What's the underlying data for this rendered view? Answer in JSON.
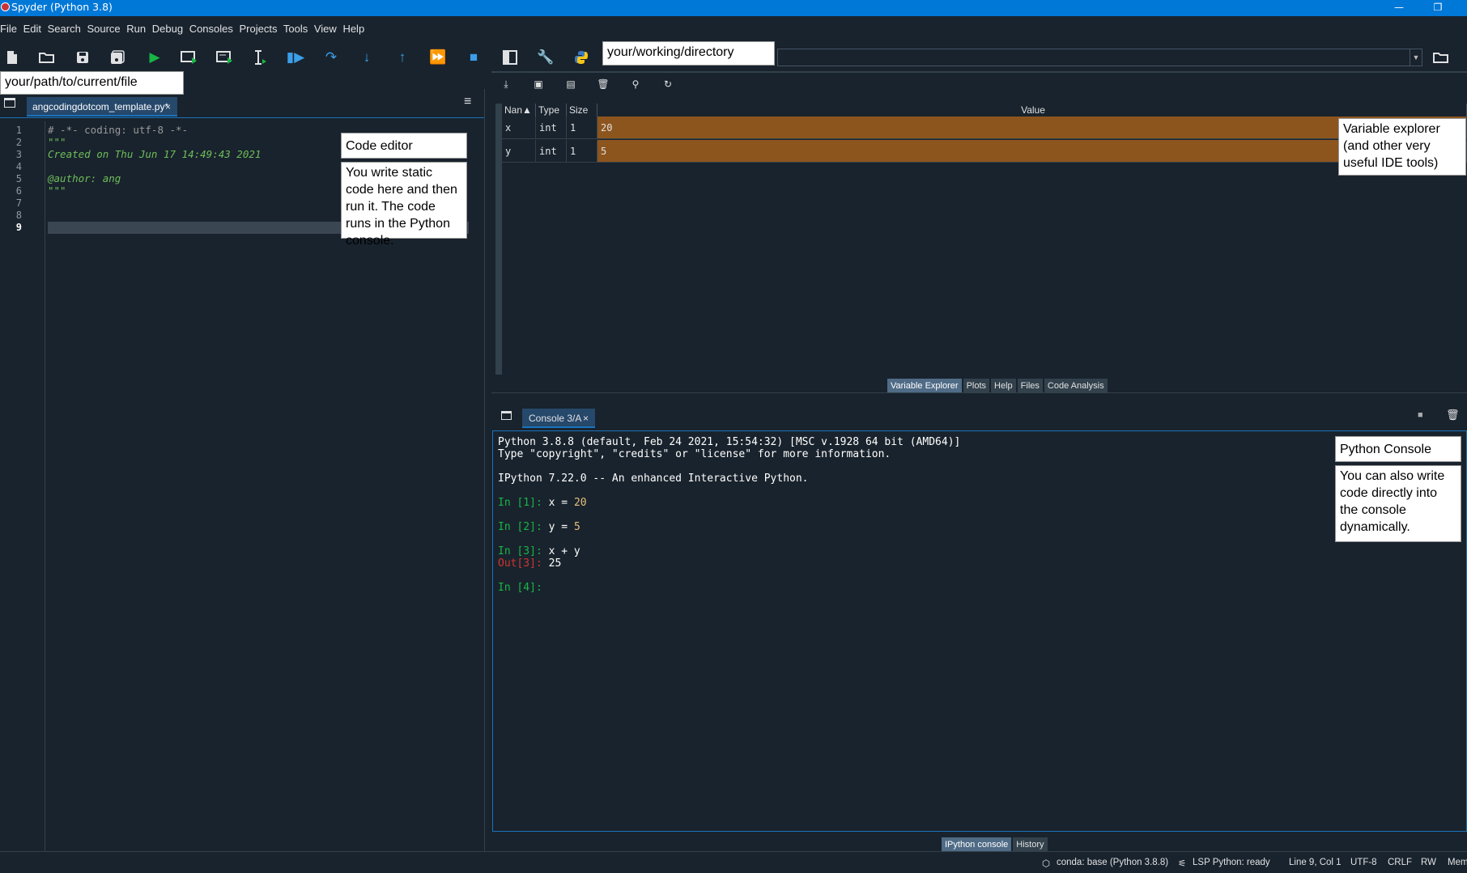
{
  "window": {
    "title": "Spyder (Python 3.8)",
    "minimize": "—",
    "restore": "❐"
  },
  "menu": [
    "File",
    "Edit",
    "Search",
    "Source",
    "Run",
    "Debug",
    "Consoles",
    "Projects",
    "Tools",
    "View",
    "Help"
  ],
  "toolbar": {
    "icons": [
      "new-file-icon",
      "open-file-icon",
      "save-icon",
      "save-all-icon",
      "run-icon",
      "run-cell-icon",
      "run-cell-advance-icon",
      "run-selection-icon",
      "debug-icon",
      "step-icon",
      "step-into-icon",
      "step-return-icon",
      "continue-icon",
      "stop-icon",
      "maximize-pane-icon",
      "preferences-icon",
      "python-path-icon"
    ],
    "browse_icon": "folder-icon"
  },
  "annotations": {
    "working_directory": "your/working/directory",
    "current_file": "your/path/to/current/file",
    "editor_title": "Code editor",
    "editor_desc": "You write static code here and then run it. The code runs in the Python console.",
    "varexp_desc": "Variable explorer (and other very useful IDE tools)",
    "console_title": "Python Console",
    "console_desc": "You can also write code directly into the console dynamically."
  },
  "editor": {
    "tab_label": "angcodingdotcom_template.py*",
    "tab_close": "×",
    "options_icon": "≡",
    "line_numbers": [
      "1",
      "2",
      "3",
      "4",
      "5",
      "6",
      "7",
      "8",
      "9"
    ],
    "current_line": "9",
    "lines": [
      {
        "text": "# -*- coding: utf-8 -*-",
        "style": "comment"
      },
      {
        "text": "\"\"\"",
        "style": "doc"
      },
      {
        "text": "Created on Thu Jun 17 14:49:43 2021",
        "style": "doc"
      },
      {
        "text": "",
        "style": "doc"
      },
      {
        "text": "@author: ang",
        "style": "doc"
      },
      {
        "text": "\"\"\"",
        "style": "doc"
      },
      {
        "text": "",
        "style": "doc"
      },
      {
        "text": "",
        "style": "doc"
      },
      {
        "text": "",
        "style": "doc"
      }
    ]
  },
  "variable_explorer": {
    "columns": [
      "Nan▲",
      "Type",
      "Size",
      "Value"
    ],
    "rows": [
      {
        "name": "x",
        "type": "int",
        "size": "1",
        "value": "20"
      },
      {
        "name": "y",
        "type": "int",
        "size": "1",
        "value": "5"
      }
    ],
    "pane_tabs": [
      "Variable Explorer",
      "Plots",
      "Help",
      "Files",
      "Code Analysis"
    ],
    "active_tab": "Variable Explorer",
    "toolbar_icons": [
      "import-data-icon",
      "save-data-icon",
      "save-as-icon",
      "remove-all-icon",
      "search-icon",
      "refresh-icon"
    ]
  },
  "console": {
    "tab_label": "Console 3/A",
    "tab_close": "×",
    "banner1": "Python 3.8.8 (default, Feb 24 2021, 15:54:32) [MSC v.1928 64 bit (AMD64)]",
    "banner2": "Type \"copyright\", \"credits\" or \"license\" for more information.",
    "banner3": "IPython 7.22.0 -- An enhanced Interactive Python.",
    "in1_prompt": "In [1]:",
    "in1_code": " x = ",
    "in1_num": "20",
    "in2_prompt": "In [2]:",
    "in2_code": " y = ",
    "in2_num": "5",
    "in3_prompt": "In [3]:",
    "in3_code": " x + y",
    "out3_prompt": "Out[3]:",
    "out3_value": " 25",
    "in4_prompt": "In [4]:",
    "pane_tabs": [
      "IPython console",
      "History"
    ],
    "active_tab": "IPython console"
  },
  "statusbar": {
    "env": "conda: base (Python 3.8.8)",
    "lsp": "LSP Python: ready",
    "position": "Line 9, Col 1",
    "encoding": "UTF-8",
    "eol": "CRLF",
    "mode": "RW",
    "mem": "Mem"
  },
  "colors": {
    "accent": "#1a72bb",
    "titlebar": "#0078d7",
    "background": "#19232d",
    "var_value_bg": "#8d551e"
  }
}
